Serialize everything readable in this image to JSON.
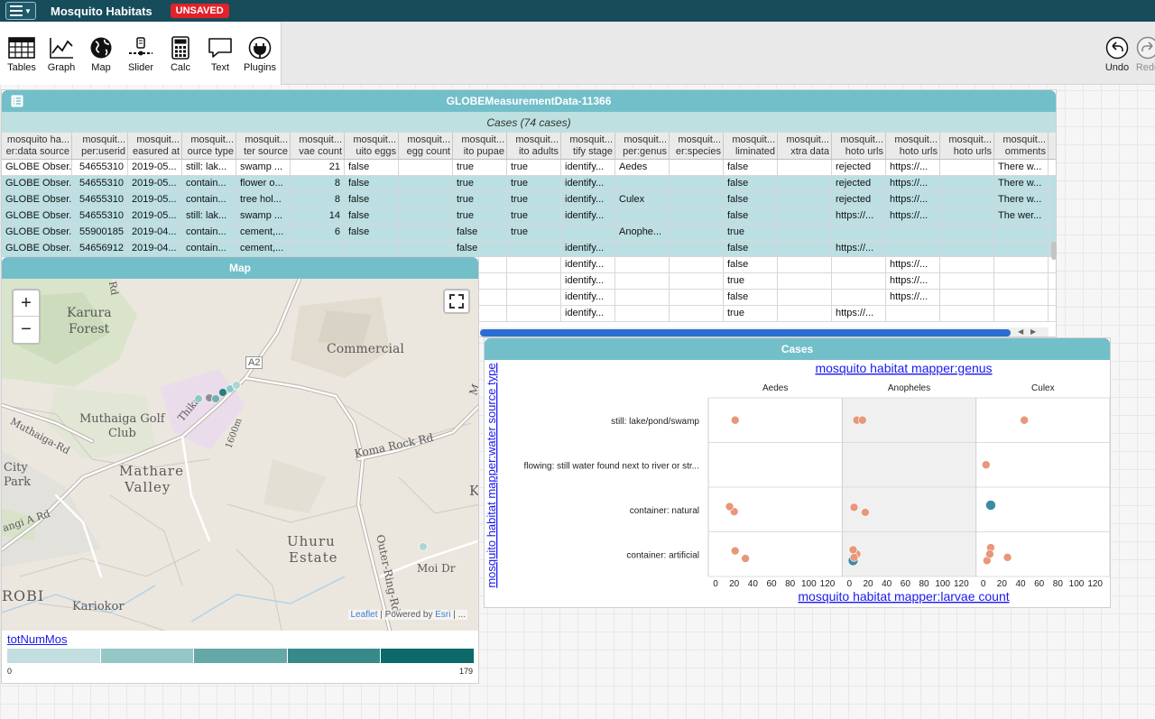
{
  "menubar": {
    "title": "Mosquito Habitats",
    "unsaved": "UNSAVED"
  },
  "tools": [
    {
      "label": "Tables",
      "icon": "table-icon"
    },
    {
      "label": "Graph",
      "icon": "graph-icon"
    },
    {
      "label": "Map",
      "icon": "map-icon"
    },
    {
      "label": "Slider",
      "icon": "slider-icon"
    },
    {
      "label": "Calc",
      "icon": "calculator-icon"
    },
    {
      "label": "Text",
      "icon": "text-icon"
    },
    {
      "label": "Plugins",
      "icon": "plugins-icon"
    }
  ],
  "right_tools": {
    "undo": "Undo",
    "redo": "Redo"
  },
  "table": {
    "title": "GLOBEMeasurementData-11366",
    "cases_header": "Cases (74 cases)",
    "columns": [
      [
        "mosquito ha...",
        "er:data source"
      ],
      [
        "mosquit...",
        "per:userid"
      ],
      [
        "mosquit...",
        "easured at"
      ],
      [
        "mosquit...",
        "ource type"
      ],
      [
        "mosquit...",
        "ter source"
      ],
      [
        "mosquit...",
        "vae count"
      ],
      [
        "mosquit...",
        "uito eggs"
      ],
      [
        "mosquit...",
        "egg count"
      ],
      [
        "mosquit...",
        "ito pupae"
      ],
      [
        "mosquit...",
        "ito adults"
      ],
      [
        "mosquit...",
        "tify stage"
      ],
      [
        "mosquit...",
        "per:genus"
      ],
      [
        "mosquit...",
        "er:species"
      ],
      [
        "mosquit...",
        "liminated"
      ],
      [
        "mosquit...",
        "xtra data"
      ],
      [
        "mosquit...",
        "hoto urls"
      ],
      [
        "mosquit...",
        "hoto urls"
      ],
      [
        "mosquit...",
        "hoto urls"
      ],
      [
        "mosquit...",
        "omments"
      ]
    ],
    "rows": [
      [
        "GLOBE Obser...",
        "54655310",
        "2019-05...",
        "still: lak...",
        "swamp ...",
        "21",
        "false",
        "",
        "true",
        "true",
        "identify...",
        "Aedes",
        "",
        "false",
        "",
        "rejected",
        "https://...",
        "",
        "There w..."
      ],
      [
        "GLOBE Obser...",
        "54655310",
        "2019-05...",
        "contain...",
        "flower o...",
        "8",
        "false",
        "",
        "true",
        "true",
        "identify...",
        "",
        "",
        "false",
        "",
        "rejected",
        "https://...",
        "",
        "There w..."
      ],
      [
        "GLOBE Obser...",
        "54655310",
        "2019-05...",
        "contain...",
        "tree hol...",
        "8",
        "false",
        "",
        "true",
        "true",
        "identify...",
        "Culex",
        "",
        "false",
        "",
        "rejected",
        "https://...",
        "",
        "There w..."
      ],
      [
        "GLOBE Obser...",
        "54655310",
        "2019-05...",
        "still: lak...",
        "swamp ...",
        "14",
        "false",
        "",
        "true",
        "true",
        "identify...",
        "",
        "",
        "false",
        "",
        "https://...",
        "https://...",
        "",
        "The wer..."
      ],
      [
        "GLOBE Obser...",
        "55900185",
        "2019-04...",
        "contain...",
        "cement,...",
        "6",
        "false",
        "",
        "false",
        "true",
        "",
        "Anophe...",
        "",
        "true",
        "",
        "",
        "",
        "",
        ""
      ],
      [
        "GLOBE Obser...",
        "54656912",
        "2019-04...",
        "contain...",
        "cement,...",
        "",
        "",
        "",
        "false",
        "",
        "identify...",
        "",
        "",
        "false",
        "",
        "https://...",
        "",
        "",
        ""
      ],
      [
        "",
        "",
        "",
        "",
        "",
        "",
        "",
        "",
        "",
        "",
        "identify...",
        "",
        "",
        "false",
        "",
        "",
        "https://...",
        "",
        ""
      ],
      [
        "",
        "",
        "",
        "",
        "",
        "",
        "",
        "",
        "",
        "",
        "identify...",
        "",
        "",
        "true",
        "",
        "",
        "https://...",
        "",
        ""
      ],
      [
        "",
        "",
        "",
        "",
        "",
        "",
        "",
        "",
        "",
        "",
        "identify...",
        "",
        "",
        "false",
        "",
        "",
        "https://...",
        "",
        ""
      ],
      [
        "",
        "",
        "",
        "",
        "",
        "",
        "",
        "",
        "",
        "",
        "identify...",
        "",
        "",
        "true",
        "",
        "https://...",
        "",
        "",
        ""
      ]
    ],
    "selected_rows": [
      1,
      2,
      3,
      4,
      5
    ]
  },
  "map": {
    "title": "Map",
    "zoom_in": "+",
    "zoom_out": "−",
    "labels": [
      "Karura",
      "Forest",
      "Commercial",
      "A2",
      "Muthaiga Golf",
      "Club",
      "Muthaiga-Rd",
      "Thika",
      "Koma Rock Rd",
      "City",
      "Park",
      "Mathare",
      "Valley",
      "Uhuru",
      "Estate",
      "Outer-Ring-Rd",
      "ROBI",
      "Kariokor",
      "Moi Dr",
      "K",
      "M",
      "Rd",
      "angi A Rd",
      "1600m"
    ],
    "attribution": {
      "leaflet": "Leaflet",
      "sep": " | Powered by ",
      "esri": "Esri",
      "tail": " | ..."
    },
    "legend": {
      "title": "totNumMos",
      "min": "0",
      "max": "179",
      "colors": [
        "#c2dede",
        "#96c7c7",
        "#66a8a8",
        "#388a8a",
        "#0d6a6a"
      ]
    },
    "point_colors": [
      "#8ec9c9",
      "#6fb0b0",
      "#2e7c7c",
      "#8e8e8e",
      "#aed4d4"
    ]
  },
  "graph": {
    "title": "Cases",
    "top_axis_label": "mosquito habitat mapper:genus",
    "left_axis_label": "mosquito habitat mapper:water source type",
    "bottom_axis_label": "mosquito habitat mapper:larvae count",
    "point_color": "#e8977a",
    "selected_color": "#3a8aa6",
    "band_color": "#f0f0f0"
  },
  "chart_data": {
    "type": "scatter",
    "title": "",
    "xlabel": "mosquito habitat mapper:larvae count",
    "ylabel": "mosquito habitat mapper:water source type",
    "top_label": "mosquito habitat mapper:genus",
    "columns": [
      "Aedes",
      "Anopheles",
      "Culex"
    ],
    "rows": [
      "still: lake/pond/swamp",
      "flowing: still water found next to river or str...",
      "container: natural",
      "container: artificial"
    ],
    "xlim": [
      0,
      130
    ],
    "xticks": [
      "0",
      "20",
      "40",
      "60",
      "80",
      "100",
      "120"
    ],
    "grid": true,
    "points": [
      {
        "col": "Aedes",
        "row": "still: lake/pond/swamp",
        "x": 21
      },
      {
        "col": "Anopheles",
        "row": "still: lake/pond/swamp",
        "x": 8
      },
      {
        "col": "Anopheles",
        "row": "still: lake/pond/swamp",
        "x": 14
      },
      {
        "col": "Culex",
        "row": "still: lake/pond/swamp",
        "x": 44
      },
      {
        "col": "Culex",
        "row": "flowing: still water found next to river or str...",
        "x": 3
      },
      {
        "col": "Aedes",
        "row": "container: natural",
        "x": 20
      },
      {
        "col": "Aedes",
        "row": "container: natural",
        "x": 15
      },
      {
        "col": "Anopheles",
        "row": "container: natural",
        "x": 5
      },
      {
        "col": "Anopheles",
        "row": "container: natural",
        "x": 17
      },
      {
        "col": "Culex",
        "row": "container: natural",
        "x": 8,
        "selected": true
      },
      {
        "col": "Anopheles",
        "row": "container: artificial",
        "x": 4,
        "selected": true
      },
      {
        "col": "Anopheles",
        "row": "container: artificial",
        "x": 8
      },
      {
        "col": "Anopheles",
        "row": "container: artificial",
        "x": 5
      },
      {
        "col": "Anopheles",
        "row": "container: artificial",
        "x": 4
      },
      {
        "col": "Aedes",
        "row": "container: artificial",
        "x": 21
      },
      {
        "col": "Aedes",
        "row": "container: artificial",
        "x": 32
      },
      {
        "col": "Culex",
        "row": "container: artificial",
        "x": 8
      },
      {
        "col": "Culex",
        "row": "container: artificial",
        "x": 4
      },
      {
        "col": "Culex",
        "row": "container: artificial",
        "x": 7
      },
      {
        "col": "Culex",
        "row": "container: artificial",
        "x": 26
      }
    ]
  }
}
